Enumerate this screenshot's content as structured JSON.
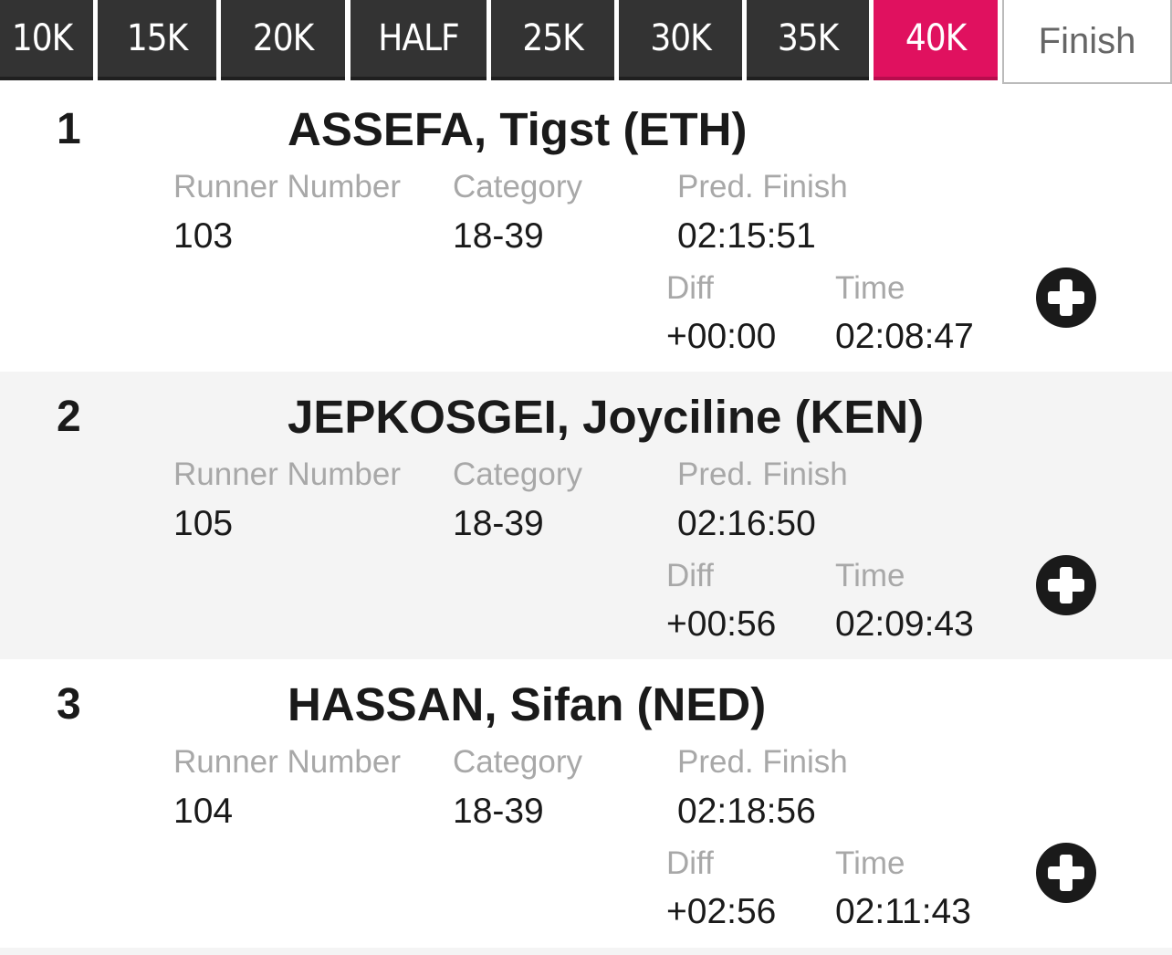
{
  "tabs": [
    {
      "label": "10K"
    },
    {
      "label": "15K"
    },
    {
      "label": "20K"
    },
    {
      "label": "HALF"
    },
    {
      "label": "25K"
    },
    {
      "label": "30K"
    },
    {
      "label": "35K"
    },
    {
      "label": "40K",
      "active": true
    },
    {
      "label": "Finish"
    }
  ],
  "labels": {
    "runner_number": "Runner Number",
    "category": "Category",
    "pred_finish": "Pred. Finish",
    "diff": "Diff",
    "time": "Time"
  },
  "colors": {
    "tab_bg": "#333333",
    "active_tab": "#e0115f",
    "alt_row": "#f4f4f4"
  },
  "results": [
    {
      "rank": "1",
      "name": "ASSEFA, Tigst (ETH)",
      "runner_number": "103",
      "category": "18-39",
      "pred_finish": "02:15:51",
      "diff": "+00:00",
      "time": "02:08:47",
      "expand_icon": "plus-circle-icon"
    },
    {
      "rank": "2",
      "name": "JEPKOSGEI, Joyciline (KEN)",
      "runner_number": "105",
      "category": "18-39",
      "pred_finish": "02:16:50",
      "diff": "+00:56",
      "time": "02:09:43",
      "expand_icon": "plus-circle-icon"
    },
    {
      "rank": "3",
      "name": "HASSAN, Sifan (NED)",
      "runner_number": "104",
      "category": "18-39",
      "pred_finish": "02:18:56",
      "diff": "+02:56",
      "time": "02:11:43",
      "expand_icon": "plus-circle-icon"
    }
  ]
}
